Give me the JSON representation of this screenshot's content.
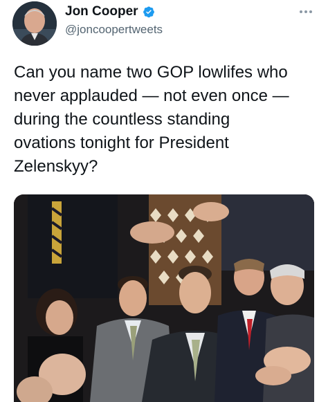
{
  "author": {
    "display_name": "Jon Cooper",
    "handle": "@joncoopertweets",
    "verified": true,
    "avatar_icon": "profile-photo"
  },
  "tweet": {
    "text": "Can you name two GOP lowlifes who\nnever applauded — not even once —\nduring the countless standing\novations tonight for President\nZelenskyy?"
  },
  "icons": {
    "verified": "verified-badge-icon",
    "more": "more-options-icon"
  },
  "colors": {
    "text": "#0f1419",
    "secondary": "#536471",
    "verified_blue": "#1d9bf0"
  }
}
